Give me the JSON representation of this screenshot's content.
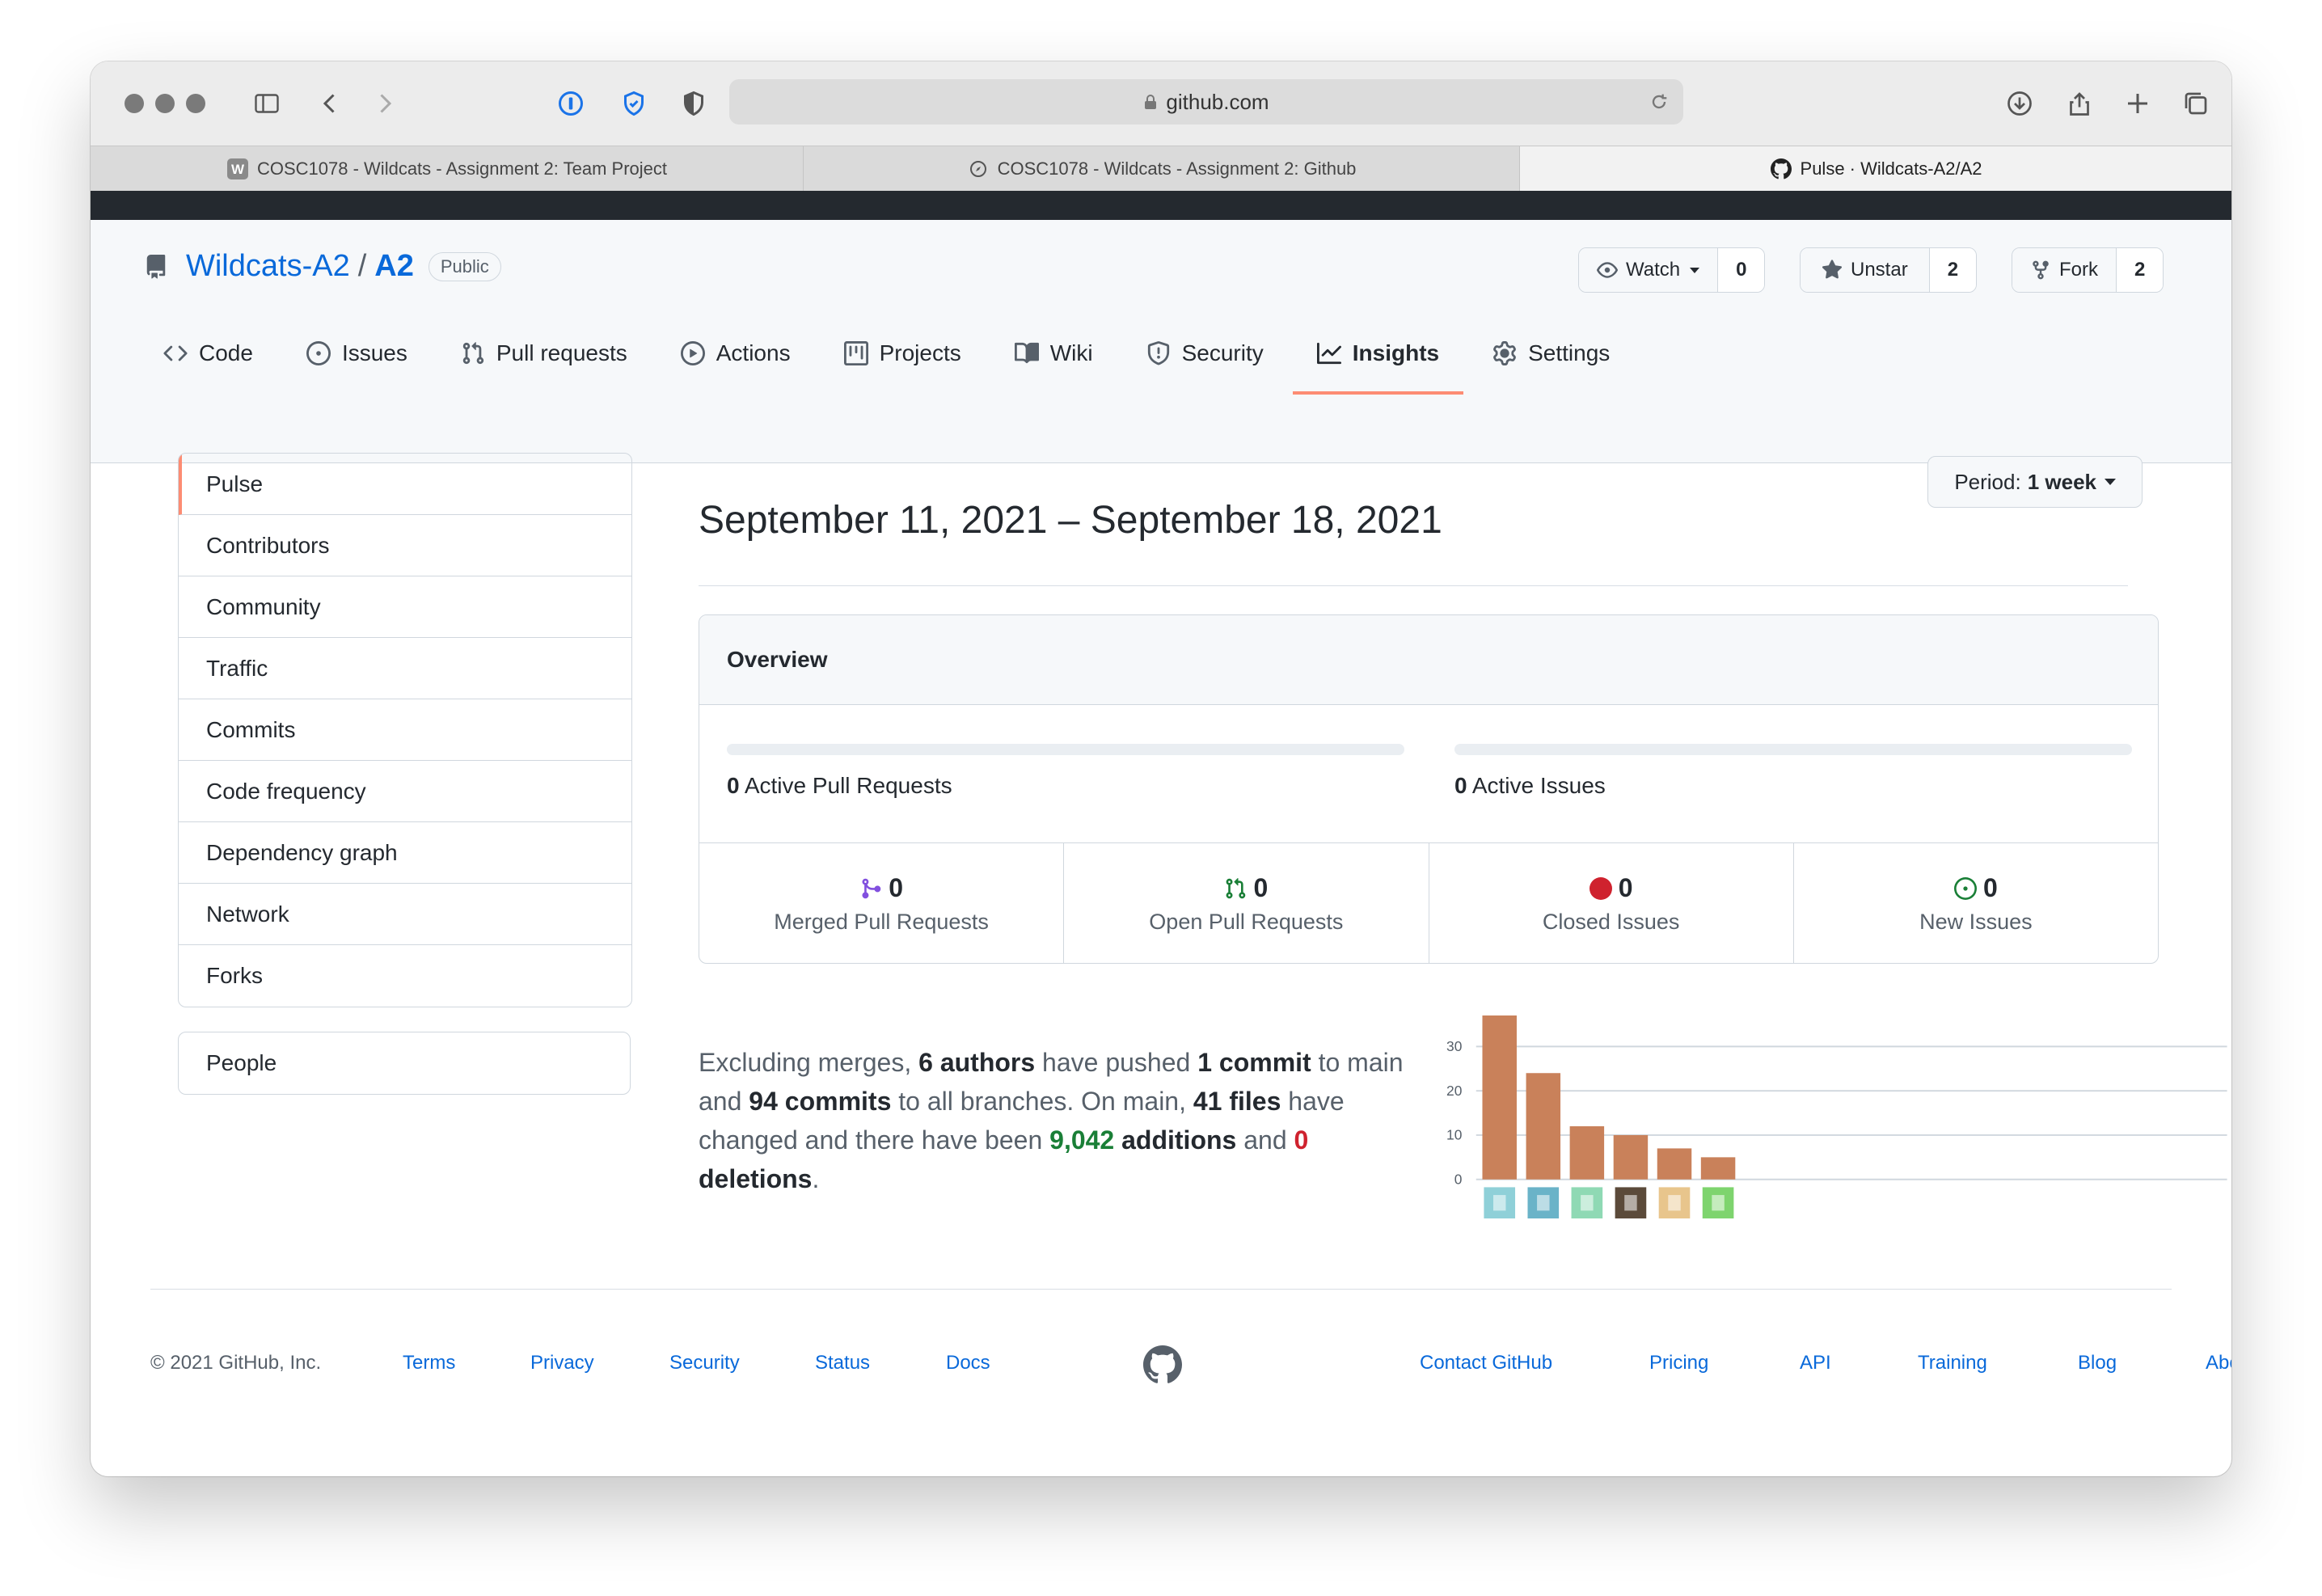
{
  "browser": {
    "url": "github.com",
    "tabs": [
      {
        "label": "COSC1078 - Wildcats - Assignment 2: Team Project",
        "favicon": "w-icon"
      },
      {
        "label": "COSC1078 - Wildcats - Assignment 2: Github",
        "favicon": "compass-icon"
      },
      {
        "label": "Pulse · Wildcats-A2/A2",
        "favicon": "github-icon"
      }
    ]
  },
  "repo": {
    "owner": "Wildcats-A2",
    "separator": "/",
    "name": "A2",
    "visibility": "Public",
    "watch": {
      "label": "Watch",
      "count": "0"
    },
    "star": {
      "label": "Unstar",
      "count": "2"
    },
    "fork": {
      "label": "Fork",
      "count": "2"
    }
  },
  "nav": [
    {
      "label": "Code",
      "icon": "code-icon"
    },
    {
      "label": "Issues",
      "icon": "issue-icon"
    },
    {
      "label": "Pull requests",
      "icon": "pull-request-icon"
    },
    {
      "label": "Actions",
      "icon": "play-icon"
    },
    {
      "label": "Projects",
      "icon": "project-icon"
    },
    {
      "label": "Wiki",
      "icon": "book-icon"
    },
    {
      "label": "Security",
      "icon": "shield-icon"
    },
    {
      "label": "Insights",
      "icon": "graph-icon",
      "selected": true
    },
    {
      "label": "Settings",
      "icon": "gear-icon"
    }
  ],
  "sidebar": {
    "items": [
      "Pulse",
      "Contributors",
      "Community",
      "Traffic",
      "Commits",
      "Code frequency",
      "Dependency graph",
      "Network",
      "Forks"
    ],
    "people": "People"
  },
  "main": {
    "period_title": "September 11, 2021 – September 18, 2021",
    "period_button_prefix": "Period:",
    "period_button_value": "1 week",
    "overview": {
      "title": "Overview",
      "active_prs_count": "0",
      "active_prs_label": "Active Pull Requests",
      "active_issues_count": "0",
      "active_issues_label": "Active Issues",
      "stats": [
        {
          "count": "0",
          "label": "Merged Pull Requests",
          "icon": "merge-icon",
          "color": "#8250df"
        },
        {
          "count": "0",
          "label": "Open Pull Requests",
          "icon": "pull-request-icon",
          "color": "#1a7f37"
        },
        {
          "count": "0",
          "label": "Closed Issues",
          "icon": "issue-closed-icon",
          "color": "#cf222e"
        },
        {
          "count": "0",
          "label": "New Issues",
          "icon": "issue-opened-icon",
          "color": "#1a7f37"
        }
      ]
    },
    "summary": {
      "t1": "Excluding merges, ",
      "authors": "6 authors",
      "t2": " have pushed ",
      "commit": "1 commit",
      "t3": " to main and ",
      "commits_all": "94 commits",
      "t4": " to all branches. On main, ",
      "files": "41 files",
      "t5": " have changed and there have been ",
      "additions_num": "9,042",
      "additions_word": " additions",
      "t6": " and ",
      "deletions_num": "0",
      "deletions_word": " deletions",
      "t7": "."
    }
  },
  "chart_data": {
    "type": "bar",
    "categories": [
      "author-1",
      "author-2",
      "author-3",
      "author-4",
      "author-5",
      "author-6"
    ],
    "values": [
      37,
      24,
      12,
      10,
      7,
      5
    ],
    "ylim": [
      0,
      37
    ],
    "yticks": [
      "0",
      "10",
      "20",
      "30"
    ],
    "bar_color": "#c9815a",
    "avatar_colors": [
      "#8fd0d8",
      "#6ab3c8",
      "#8fd9b4",
      "#5b4a3a",
      "#e8c58c",
      "#7ed46e"
    ]
  },
  "footer": {
    "copyright": "© 2021 GitHub, Inc.",
    "left_links": [
      "Terms",
      "Privacy",
      "Security",
      "Status",
      "Docs"
    ],
    "right_links": [
      "Contact GitHub",
      "Pricing",
      "API",
      "Training",
      "Blog",
      "About"
    ]
  }
}
